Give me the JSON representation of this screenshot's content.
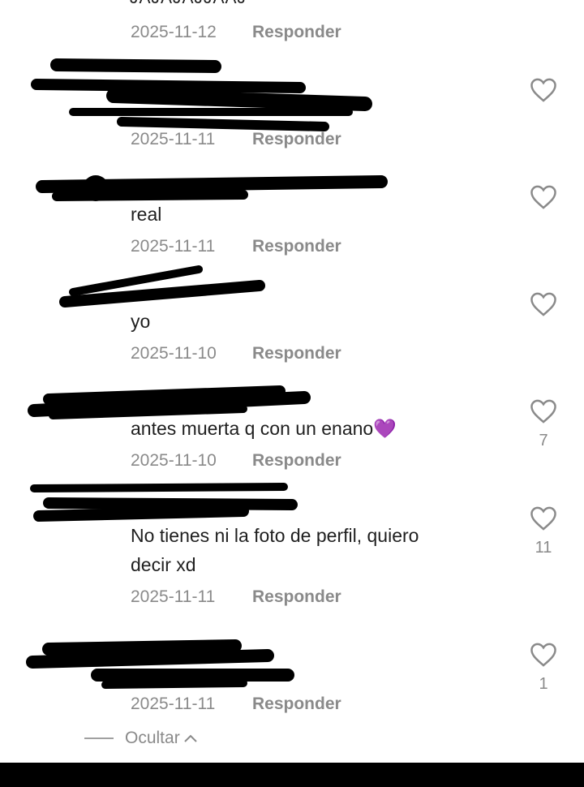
{
  "top_partial_text": "JAJAJAJJAAJ",
  "reply_label": "Responder",
  "comments": [
    {
      "date": "2025-11-12",
      "text": "",
      "likes": ""
    },
    {
      "date": "2025-11-11",
      "text": "",
      "likes": ""
    },
    {
      "date": "2025-11-11",
      "text": "real",
      "likes": ""
    },
    {
      "date": "2025-11-10",
      "text": "yo",
      "likes": ""
    },
    {
      "date": "2025-11-10",
      "text": "antes muerta q con un enano",
      "emoji": "💜",
      "likes": "7"
    },
    {
      "date": "2025-11-11",
      "text_line1": "No tienes ni la foto de perfil, quiero",
      "text_line2": "decir xd",
      "likes": "11"
    },
    {
      "date": "2025-11-11",
      "text": "",
      "likes": "1"
    }
  ],
  "hide_label": "Ocultar",
  "colors": {
    "text": "#1f1f1f",
    "meta": "#8a8a8a",
    "redaction": "#000000",
    "bottom_bar": "#000000"
  },
  "icons": {
    "like": "heart-outline-icon",
    "hide": "chevron-up-icon"
  }
}
